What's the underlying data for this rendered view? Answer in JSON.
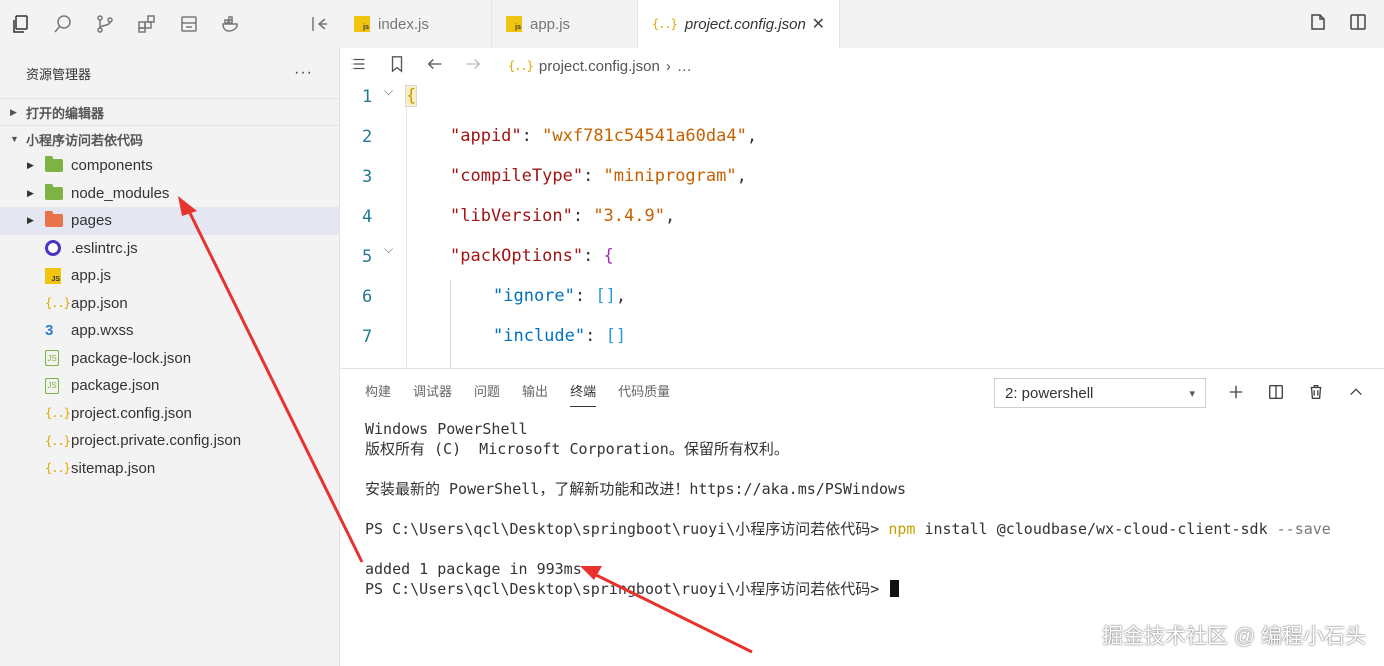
{
  "sidebar": {
    "title": "资源管理器",
    "more": "···",
    "sections": {
      "open_editors": "打开的编辑器",
      "project": "小程序访问若依代码"
    },
    "items": [
      {
        "label": "components"
      },
      {
        "label": "node_modules"
      },
      {
        "label": "pages"
      },
      {
        "label": ".eslintrc.js"
      },
      {
        "label": "app.js"
      },
      {
        "label": "app.json"
      },
      {
        "label": "app.wxss"
      },
      {
        "label": "package-lock.json"
      },
      {
        "label": "package.json"
      },
      {
        "label": "project.config.json"
      },
      {
        "label": "project.private.config.json"
      },
      {
        "label": "sitemap.json"
      }
    ],
    "json_glyph": "{..}",
    "js_glyph": "JS",
    "css_glyph": "3",
    "node_glyph": "JS"
  },
  "tabs": [
    {
      "label": "index.js",
      "icon": "js"
    },
    {
      "label": "app.js",
      "icon": "js"
    },
    {
      "label": "project.config.json",
      "icon": "{..}",
      "close": "✕"
    }
  ],
  "breadcrumb": {
    "file_icon": "{..}",
    "file": "project.config.json",
    "separator": "›",
    "rest": "…"
  },
  "editor": {
    "line_numbers": [
      "1",
      "2",
      "3",
      "4",
      "5",
      "6",
      "7"
    ],
    "lines": {
      "l1": "{",
      "appid_key": "\"appid\"",
      "appid_val": "\"wxf781c54541a60da4\"",
      "compile_key": "\"compileType\"",
      "compile_val": "\"miniprogram\"",
      "lib_key": "\"libVersion\"",
      "lib_val": "\"3.4.9\"",
      "pack_key": "\"packOptions\"",
      "pack_open": "{",
      "ignore_key": "\"ignore\"",
      "ignore_val": "[]",
      "include_key": "\"include\"",
      "include_val": "[]",
      "colon": ": ",
      "comma": ","
    }
  },
  "panel": {
    "tabs": [
      "构建",
      "调试器",
      "问题",
      "输出",
      "终端",
      "代码质量"
    ],
    "active_tab": "终端",
    "terminal_select": "2: powershell",
    "terminal": {
      "l1": "Windows PowerShell",
      "l2": "版权所有 (C)  Microsoft Corporation。保留所有权利。",
      "l3": "安装最新的 PowerShell，了解新功能和改进！https://aka.ms/PSWindows",
      "prompt": "PS C:\\Users\\qcl\\Desktop\\springboot\\ruoyi\\小程序访问若依代码> ",
      "cmd_npm": "npm",
      "cmd_args": " install @cloudbase/wx-cloud-client-sdk ",
      "cmd_flag": "--save",
      "result": "added 1 package in 993ms"
    }
  },
  "watermark": "掘金技术社区 @ 编程小石头",
  "colors": {
    "accent_arrow": "#e8322f",
    "folder_green": "#7cb342",
    "folder_orange": "#e8734a"
  }
}
